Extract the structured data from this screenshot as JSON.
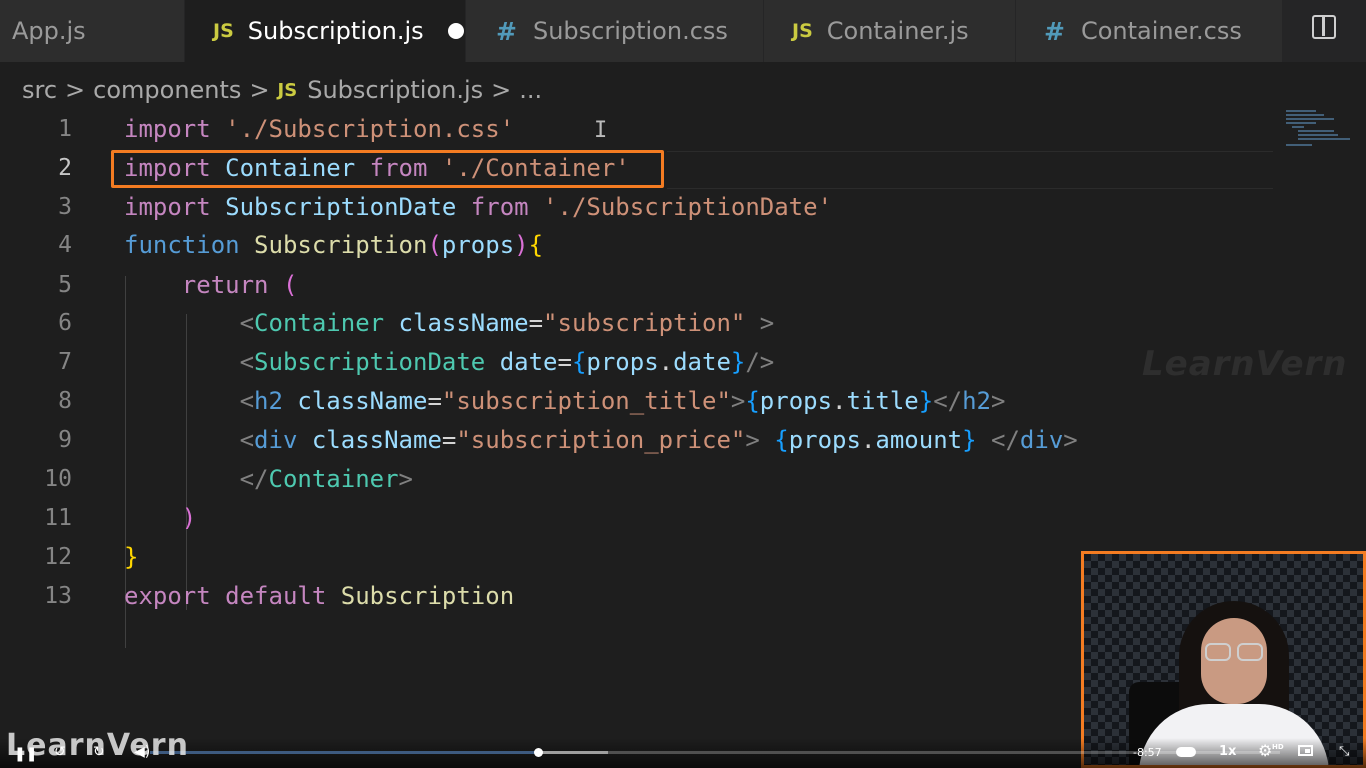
{
  "tabs": [
    {
      "label": "App.js",
      "type": "js",
      "active": false,
      "show_icon": false
    },
    {
      "label": "Subscription.js",
      "type": "js",
      "active": true,
      "modified": true
    },
    {
      "label": "Subscription.css",
      "type": "css",
      "active": false
    },
    {
      "label": "Container.js",
      "type": "js",
      "active": false
    },
    {
      "label": "Container.css",
      "type": "css",
      "active": false
    }
  ],
  "icons": {
    "js": "JS",
    "css": "#",
    "split_editor": "split-editor-icon"
  },
  "breadcrumb": {
    "parts": [
      "src",
      "components",
      "Subscription.js",
      "..."
    ],
    "separator": ">"
  },
  "editor": {
    "current_line": 2,
    "line_numbers": [
      "1",
      "2",
      "3",
      "4",
      "5",
      "6",
      "7",
      "8",
      "9",
      "10",
      "11",
      "12",
      "13"
    ],
    "lines": [
      "import './Subscription.css'",
      "import Container from './Container'",
      "import SubscriptionDate from './SubscriptionDate'",
      "function Subscription(props){",
      "    return (",
      "        <Container className=\"subscription\" >",
      "        <SubscriptionDate date={props.date}/>",
      "        <h2 className=\"subscription_title\">{props.title}</h2>",
      "        <div className=\"subscription_price\"> {props.amount} </div>",
      "        </Container>",
      "    )",
      "}",
      "export default Subscription"
    ],
    "highlight_color": "#f47c22"
  },
  "watermark": "LearnVern",
  "player": {
    "logo": "LearnVern",
    "time_remaining": "-8:57",
    "speed": "1x",
    "quality": "HD",
    "progress_fraction": 0.34,
    "accent": "#f47c22"
  }
}
